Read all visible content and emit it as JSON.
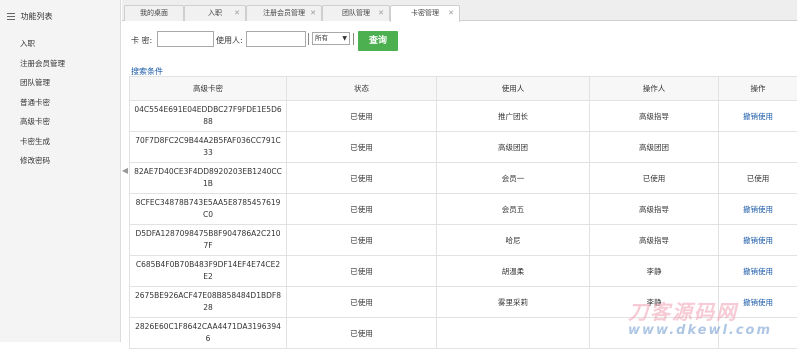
{
  "sidebar": {
    "title": "功能列表",
    "items": [
      "入职",
      "注册会员管理",
      "团队管理",
      "普通卡密",
      "高级卡密",
      "卡密生成",
      "修改密码"
    ]
  },
  "tabs": [
    {
      "label": "我的桌面",
      "active": false
    },
    {
      "label": "入职",
      "active": false
    },
    {
      "label": "注册会员管理",
      "active": false
    },
    {
      "label": "团队管理",
      "active": false
    },
    {
      "label": "卡密管理",
      "active": true
    }
  ],
  "search": {
    "card_label": "卡 密:",
    "card_value": "",
    "user_label": "使用人:",
    "user_value": "",
    "status_selected": "所有",
    "query_button": "查询",
    "conditions_link": "搜索条件"
  },
  "table": {
    "headers": [
      "高级卡密",
      "状态",
      "使用人",
      "操作人",
      "操作"
    ],
    "rows": [
      {
        "code": "04C554E691E04EDDBC27F9FDE1E5D688",
        "status": "已使用",
        "user": "推广团长",
        "operator": "高级指导",
        "action": "撤销使用"
      },
      {
        "code": "70F7D8FC2C9B44A2B5FAF036CC791C33",
        "status": "已使用",
        "user": "高级团团",
        "operator": "高级团团",
        "action": ""
      },
      {
        "code": "82AE7D40CE3F4DD8920203EB1240CC1B",
        "status": "已使用",
        "user": "会员一",
        "operator": "已使用",
        "action": "已使用"
      },
      {
        "code": "8CFEC34878B743E5AA5E8785457619C0",
        "status": "已使用",
        "user": "会员五",
        "operator": "高级指导",
        "action": "撤销使用"
      },
      {
        "code": "D5DFA1287098475B8F904786A2C2107F",
        "status": "已使用",
        "user": "哈尼",
        "operator": "高级指导",
        "action": "撤销使用"
      },
      {
        "code": "C685B4F0B70B483F9DF14EF4E74CE2E2",
        "status": "已使用",
        "user": "胡温柔",
        "operator": "李静",
        "action": "撤销使用"
      },
      {
        "code": "2675BE926ACF47E08B858484D1BDF828",
        "status": "已使用",
        "user": "雾里采莉",
        "operator": "李静",
        "action": "撤销使用"
      },
      {
        "code": "2826E60C1F8642CAA4471DA31963946",
        "status": "已使用",
        "user": "",
        "operator": "",
        "action": ""
      }
    ]
  },
  "watermark": {
    "line1": "刀客源码网",
    "line2": "www.dkewl.com"
  }
}
